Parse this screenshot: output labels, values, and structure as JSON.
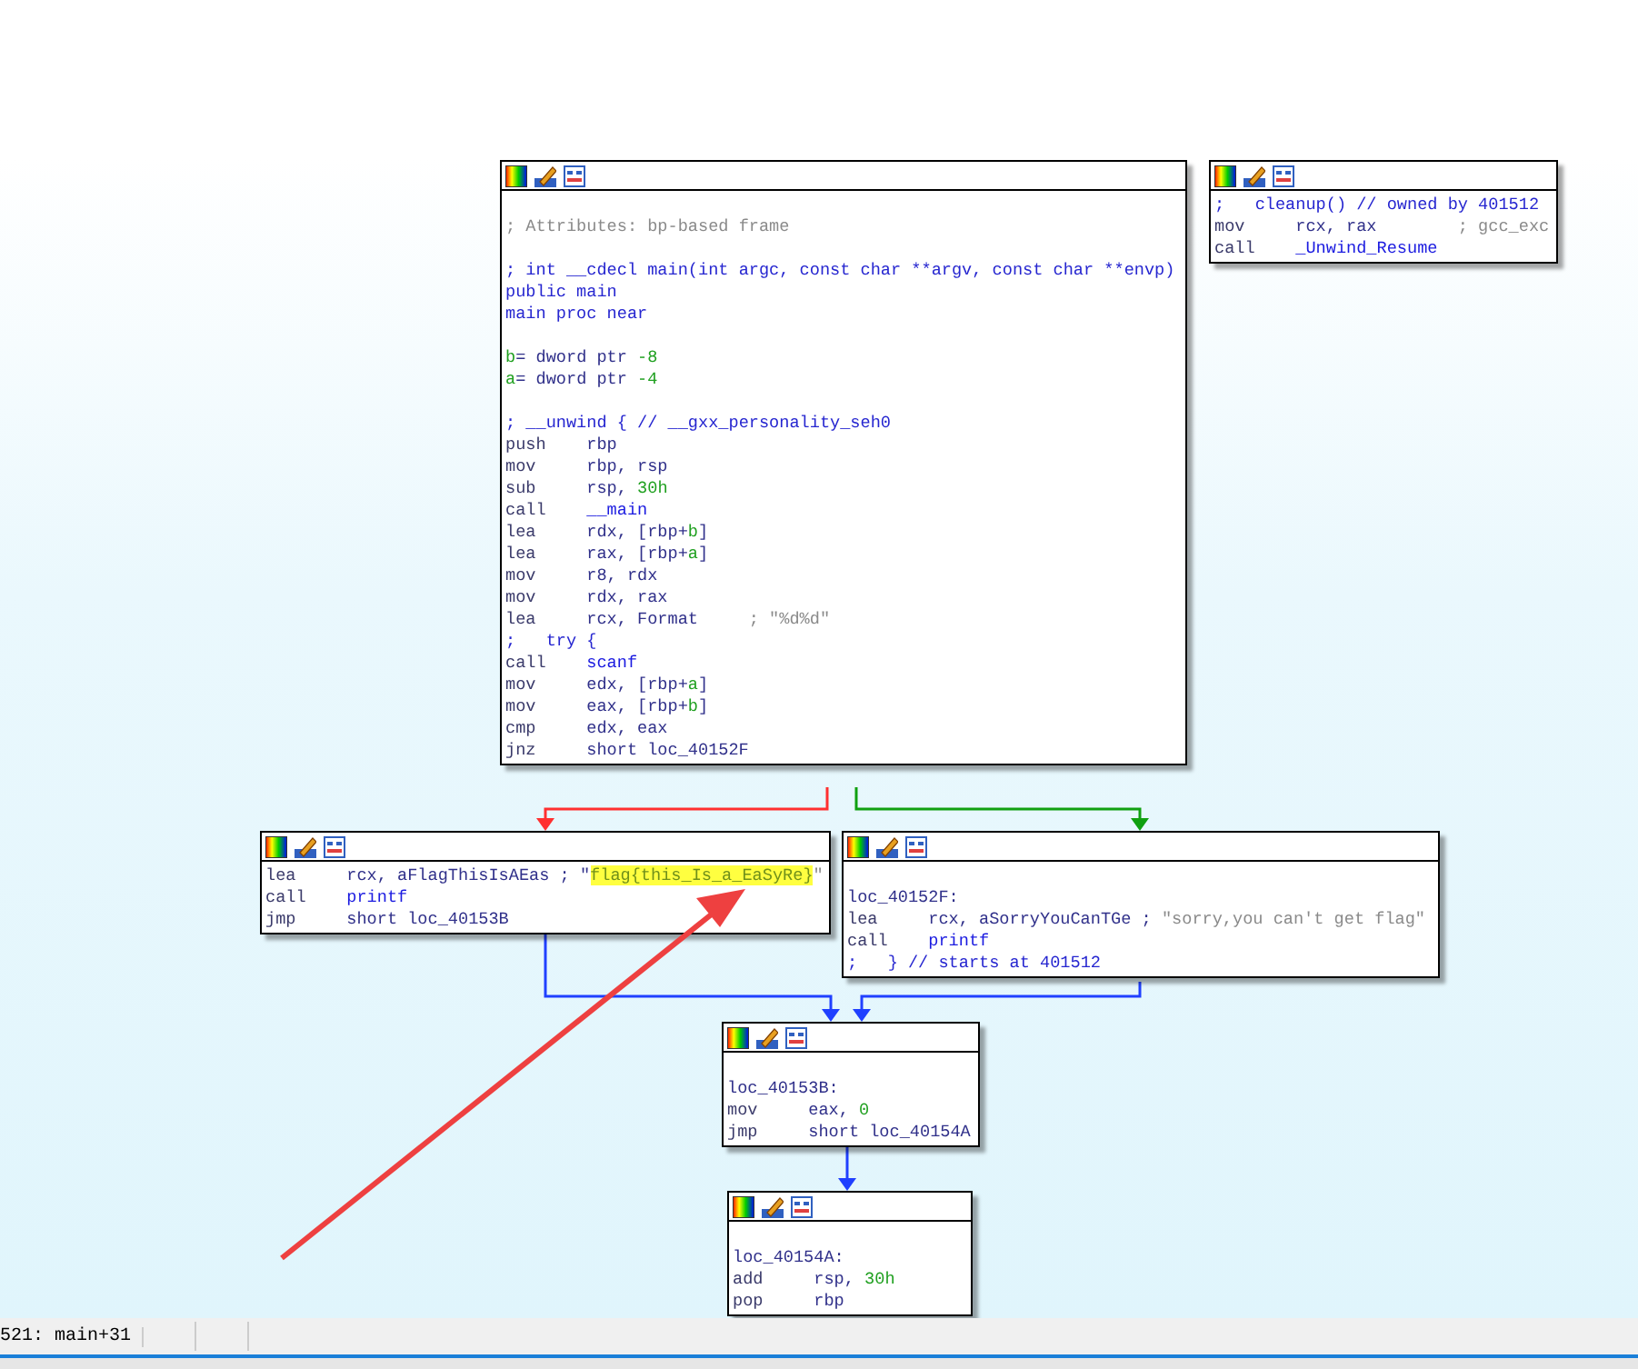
{
  "nodes": [
    {
      "leading_blank": true,
      "paragraphs": [
        [
          [
            {
              "text": "; Attributes: bp-based frame",
              "kind": "comment"
            }
          ]
        ],
        [
          [
            {
              "text": "; int __cdecl main(int argc, const char **argv, const char **envp)",
              "kind": "decl"
            }
          ],
          [
            {
              "text": "public main",
              "kind": "decl"
            }
          ],
          [
            {
              "text": "main proc near",
              "kind": "decl"
            }
          ]
        ],
        [
          [
            {
              "text": "b",
              "kind": "var"
            },
            {
              "text": "= dword ptr ",
              "kind": "op"
            },
            {
              "text": "-8",
              "kind": "num"
            }
          ],
          [
            {
              "text": "a",
              "kind": "var"
            },
            {
              "text": "= dword ptr ",
              "kind": "op"
            },
            {
              "text": "-4",
              "kind": "num"
            }
          ]
        ],
        [
          [
            {
              "text": "; __unwind { // __gxx_personality_seh0",
              "kind": "decl"
            }
          ],
          [
            {
              "text": "push",
              "kind": "mnem"
            },
            {
              "text": "rbp",
              "kind": "op"
            }
          ],
          [
            {
              "text": "mov",
              "kind": "mnem"
            },
            {
              "text": "rbp, rsp",
              "kind": "op"
            }
          ],
          [
            {
              "text": "sub",
              "kind": "mnem"
            },
            {
              "text": "rsp, ",
              "kind": "op"
            },
            {
              "text": "30h",
              "kind": "num"
            }
          ],
          [
            {
              "text": "call",
              "kind": "mnem"
            },
            {
              "text": "__main",
              "kind": "name"
            }
          ],
          [
            {
              "text": "lea",
              "kind": "mnem"
            },
            {
              "text": "rdx, [rbp+",
              "kind": "op"
            },
            {
              "text": "b",
              "kind": "var"
            },
            {
              "text": "]",
              "kind": "op"
            }
          ],
          [
            {
              "text": "lea",
              "kind": "mnem"
            },
            {
              "text": "rax, [rbp+",
              "kind": "op"
            },
            {
              "text": "a",
              "kind": "var"
            },
            {
              "text": "]",
              "kind": "op"
            }
          ],
          [
            {
              "text": "mov",
              "kind": "mnem"
            },
            {
              "text": "r8, rdx",
              "kind": "op"
            }
          ],
          [
            {
              "text": "mov",
              "kind": "mnem"
            },
            {
              "text": "rdx, rax",
              "kind": "op"
            }
          ],
          [
            {
              "text": "lea",
              "kind": "mnem"
            },
            {
              "text": "rcx, Format",
              "kind": "op"
            },
            {
              "text": "; \"%d%d\"",
              "kind": "tabcomment"
            }
          ],
          [
            {
              "text": ";   try {",
              "kind": "decl"
            }
          ],
          [
            {
              "text": "call",
              "kind": "mnem"
            },
            {
              "text": "scanf",
              "kind": "name"
            }
          ],
          [
            {
              "text": "mov",
              "kind": "mnem"
            },
            {
              "text": "edx, [rbp+",
              "kind": "op"
            },
            {
              "text": "a",
              "kind": "var"
            },
            {
              "text": "]",
              "kind": "op"
            }
          ],
          [
            {
              "text": "mov",
              "kind": "mnem"
            },
            {
              "text": "eax, [rbp+",
              "kind": "op"
            },
            {
              "text": "b",
              "kind": "var"
            },
            {
              "text": "]",
              "kind": "op"
            }
          ],
          [
            {
              "text": "cmp",
              "kind": "mnem"
            },
            {
              "text": "edx, eax",
              "kind": "op"
            }
          ],
          [
            {
              "text": "jnz",
              "kind": "mnem"
            },
            {
              "text": "short loc_40152F",
              "kind": "op"
            }
          ]
        ]
      ]
    },
    {
      "leading_blank": false,
      "paragraphs": [
        [
          [
            {
              "text": ";   cleanup() // owned by 401512",
              "kind": "decl"
            }
          ],
          [
            {
              "text": "mov",
              "kind": "mnem"
            },
            {
              "text": "rcx, rax",
              "kind": "op"
            },
            {
              "text": "; gcc_exc",
              "kind": "tabcomment2"
            }
          ],
          [
            {
              "text": "call",
              "kind": "mnem"
            },
            {
              "text": "_Unwind_Resume",
              "kind": "name"
            }
          ]
        ]
      ]
    },
    {
      "leading_blank": false,
      "paragraphs": [
        [
          [
            {
              "text": "lea",
              "kind": "mnem"
            },
            {
              "text": "rcx, aFlagThisIsAEas ; \"",
              "kind": "op"
            },
            {
              "text": "flag{this_Is_a_EaSyRe}",
              "kind": "hl"
            },
            {
              "text": "\"",
              "kind": "str"
            }
          ],
          [
            {
              "text": "call",
              "kind": "mnem"
            },
            {
              "text": "printf",
              "kind": "name"
            }
          ],
          [
            {
              "text": "jmp",
              "kind": "mnem"
            },
            {
              "text": "short loc_40153B",
              "kind": "op"
            }
          ]
        ]
      ]
    },
    {
      "leading_blank": true,
      "paragraphs": [
        [
          [
            {
              "text": "loc_40152F:",
              "kind": "op"
            }
          ],
          [
            {
              "text": "lea",
              "kind": "mnem"
            },
            {
              "text": "rcx, aSorryYouCanTGe ; ",
              "kind": "op"
            },
            {
              "text": "\"sorry,you can't get flag\"",
              "kind": "str"
            }
          ],
          [
            {
              "text": "call",
              "kind": "mnem"
            },
            {
              "text": "printf",
              "kind": "name"
            }
          ],
          [
            {
              "text": ";   } // starts at 401512",
              "kind": "decl"
            }
          ]
        ]
      ]
    },
    {
      "leading_blank": true,
      "paragraphs": [
        [
          [
            {
              "text": "loc_40153B:",
              "kind": "op"
            }
          ],
          [
            {
              "text": "mov",
              "kind": "mnem"
            },
            {
              "text": "eax, ",
              "kind": "op"
            },
            {
              "text": "0",
              "kind": "num"
            }
          ],
          [
            {
              "text": "jmp",
              "kind": "mnem"
            },
            {
              "text": "short loc_40154A",
              "kind": "op"
            }
          ]
        ]
      ]
    },
    {
      "leading_blank": true,
      "paragraphs": [
        [
          [
            {
              "text": "loc_40154A:",
              "kind": "op"
            }
          ],
          [
            {
              "text": "add",
              "kind": "mnem"
            },
            {
              "text": "rsp, ",
              "kind": "op"
            },
            {
              "text": "30h",
              "kind": "num"
            }
          ],
          [
            {
              "text": "pop",
              "kind": "mnem"
            },
            {
              "text": "rbp",
              "kind": "op"
            }
          ]
        ]
      ]
    }
  ],
  "edges": [
    {
      "color": "#ff3030"
    },
    {
      "color": "#10a010"
    },
    {
      "color": "#2040ff"
    },
    {
      "color": "#2040ff"
    },
    {
      "color": "#2040ff"
    }
  ],
  "status_bar": {
    "location": "521: main+31"
  }
}
